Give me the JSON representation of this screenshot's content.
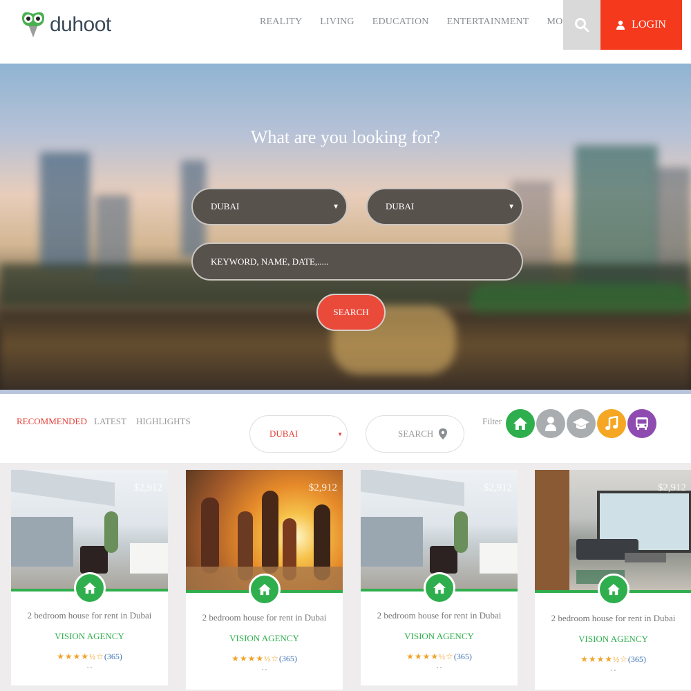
{
  "brand": {
    "name": "duhoot"
  },
  "nav": {
    "items": [
      {
        "label": "REALITY"
      },
      {
        "label": "LIVING"
      },
      {
        "label": "EDUCATION"
      },
      {
        "label": "ENTERTAINMENT"
      },
      {
        "label": "MOBILITY"
      }
    ],
    "search_icon": "search-icon",
    "login_label": "LOGIN",
    "login_icon": "user-icon"
  },
  "hero": {
    "title": "What are you looking for?",
    "select_one": "DUBAI",
    "select_two": "DUBAI",
    "keyword_placeholder": "KEYWORD, NAME, DATE,.....",
    "search_label": "SEARCH"
  },
  "filterbar": {
    "tabs": [
      {
        "label": "RECOMMENDED",
        "active": true
      },
      {
        "label": "LATEST"
      },
      {
        "label": "HIGHLIGHTS"
      }
    ],
    "city_select": "DUBAI",
    "search_label": "SEARCH",
    "filter_label": "Filter",
    "filter_icons": [
      {
        "icon": "home-icon",
        "color": "#2fae4d"
      },
      {
        "icon": "person-icon",
        "color": "#a9adb0"
      },
      {
        "icon": "graduation-cap-icon",
        "color": "#a9adb0"
      },
      {
        "icon": "music-icon",
        "color": "#f5a623"
      },
      {
        "icon": "bus-icon",
        "color": "#8e4bb0"
      }
    ]
  },
  "cards": [
    {
      "price": "$2,912",
      "title": "2 bedroom house for rent in Dubai",
      "agency": "VISION AGENCY",
      "rating": 4.5,
      "count": "(365)",
      "image": "villa-patio"
    },
    {
      "price": "$2,912",
      "title": "2 bedroom house for rent in Dubai",
      "agency": "VISION AGENCY",
      "rating": 4.5,
      "count": "(365)",
      "image": "beach-party"
    },
    {
      "price": "$2,912",
      "title": "2 bedroom house for rent in Dubai",
      "agency": "VISION AGENCY",
      "rating": 4.5,
      "count": "(365)",
      "image": "villa-patio"
    },
    {
      "price": "$2,912",
      "title": "2 bedroom house for rent in Dubai",
      "agency": "VISION AGENCY",
      "rating": 4.5,
      "count": "(365)",
      "image": "apartment-living-room"
    }
  ],
  "colors": {
    "accent_red": "#f5391c",
    "green": "#2fae4d",
    "star": "#f2a32a"
  }
}
